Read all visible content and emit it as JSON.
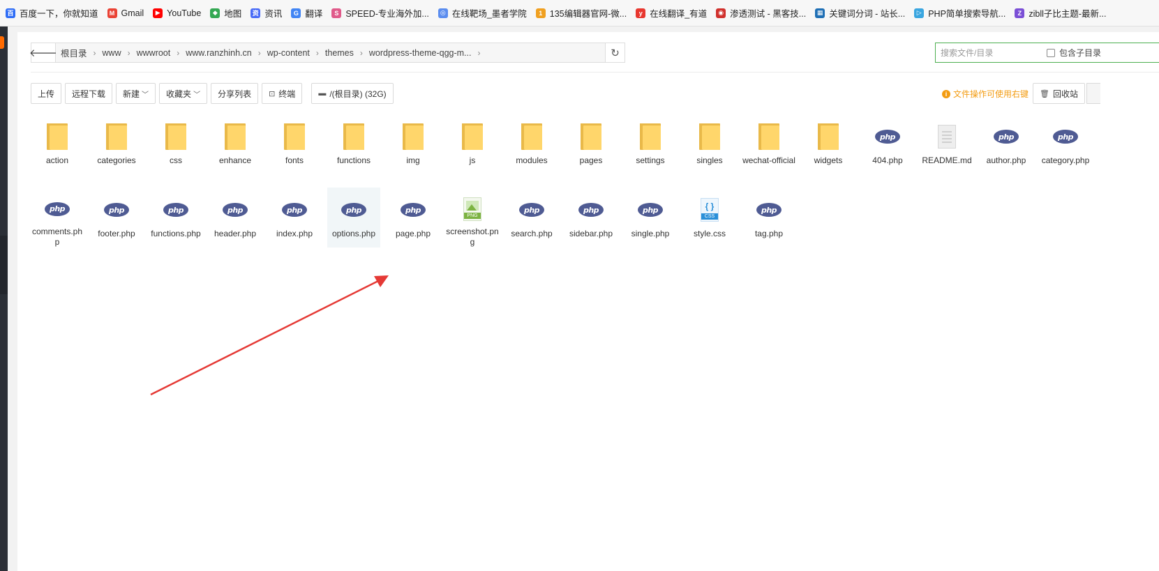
{
  "bookmarks": [
    {
      "label": "百度一下，你就知道",
      "icon": "baidu-icon",
      "color": "#2f6df6",
      "glyph": "百"
    },
    {
      "label": "Gmail",
      "icon": "gmail-icon",
      "color": "#ea4335",
      "glyph": "M"
    },
    {
      "label": "YouTube",
      "icon": "youtube-icon",
      "color": "#ff0000",
      "glyph": "▶"
    },
    {
      "label": "地图",
      "icon": "maps-icon",
      "color": "#34a853",
      "glyph": "◆"
    },
    {
      "label": "资讯",
      "icon": "news-icon",
      "color": "#4a6cf7",
      "glyph": "资"
    },
    {
      "label": "翻译",
      "icon": "translate-icon",
      "color": "#4285f4",
      "glyph": "G"
    },
    {
      "label": "SPEED-专业海外加...",
      "icon": "speed-icon",
      "color": "#e05a8a",
      "glyph": "S"
    },
    {
      "label": "在线靶场_墨者学院",
      "icon": "mozhe-icon",
      "color": "#5b8def",
      "glyph": "◎"
    },
    {
      "label": "135编辑器官网-微...",
      "icon": "editor135-icon",
      "color": "#f0a020",
      "glyph": "1"
    },
    {
      "label": "在线翻译_有道",
      "icon": "youdao-icon",
      "color": "#e8372f",
      "glyph": "y"
    },
    {
      "label": "渗透测试 - 黑客技...",
      "icon": "pentest-icon",
      "color": "#d0312d",
      "glyph": "◉"
    },
    {
      "label": "关键词分词 - 站长...",
      "icon": "keyword-icon",
      "color": "#1f6fb5",
      "glyph": "▦"
    },
    {
      "label": "PHP简单搜索导航...",
      "icon": "php-search-icon",
      "color": "#3aa6e0",
      "glyph": "▷"
    },
    {
      "label": "zibll子比主题-最新...",
      "icon": "zibll-icon",
      "color": "#7b4fd6",
      "glyph": "Z"
    }
  ],
  "address": {
    "crumbs": [
      "根目录",
      "www",
      "wwwroot",
      "www.ranzhinh.cn",
      "wp-content",
      "themes",
      "wordpress-theme-qgg-m..."
    ]
  },
  "search": {
    "placeholder": "搜索文件/目录",
    "checkbox_label": "包含子目录"
  },
  "toolbar": {
    "upload": "上传",
    "remote_download": "远程下载",
    "new": "新建",
    "favorites": "收藏夹",
    "share_list": "分享列表",
    "terminal": "终端",
    "disk": "/(根目录) (32G)"
  },
  "hint": "文件操作可使用右键",
  "recycle": "回收站",
  "files_row1": [
    {
      "name": "action",
      "type": "folder"
    },
    {
      "name": "categories",
      "type": "folder"
    },
    {
      "name": "css",
      "type": "folder"
    },
    {
      "name": "enhance",
      "type": "folder"
    },
    {
      "name": "fonts",
      "type": "folder"
    },
    {
      "name": "functions",
      "type": "folder"
    },
    {
      "name": "img",
      "type": "folder"
    },
    {
      "name": "js",
      "type": "folder"
    },
    {
      "name": "modules",
      "type": "folder"
    },
    {
      "name": "pages",
      "type": "folder"
    },
    {
      "name": "settings",
      "type": "folder"
    },
    {
      "name": "singles",
      "type": "folder"
    },
    {
      "name": "wechat-official",
      "type": "folder"
    },
    {
      "name": "widgets",
      "type": "folder"
    },
    {
      "name": "404.php",
      "type": "php"
    },
    {
      "name": "README.md",
      "type": "doc"
    },
    {
      "name": "author.php",
      "type": "php"
    },
    {
      "name": "category.php",
      "type": "php"
    }
  ],
  "files_row2": [
    {
      "name": "comments.php",
      "type": "php"
    },
    {
      "name": "footer.php",
      "type": "php"
    },
    {
      "name": "functions.php",
      "type": "php"
    },
    {
      "name": "header.php",
      "type": "php"
    },
    {
      "name": "index.php",
      "type": "php"
    },
    {
      "name": "options.php",
      "type": "php",
      "selected": true
    },
    {
      "name": "page.php",
      "type": "php"
    },
    {
      "name": "screenshot.png",
      "type": "png"
    },
    {
      "name": "search.php",
      "type": "php"
    },
    {
      "name": "sidebar.php",
      "type": "php"
    },
    {
      "name": "single.php",
      "type": "php"
    },
    {
      "name": "style.css",
      "type": "css"
    },
    {
      "name": "tag.php",
      "type": "php"
    }
  ],
  "icon_labels": {
    "php": "php",
    "png": "PNG",
    "css_tag": "CSS",
    "css_braces": "{ }"
  },
  "colors": {
    "accent_green": "#4caf50",
    "hint_orange": "#f39c12",
    "php_badge": "#4f5b93",
    "annotation_arrow": "#e53935"
  }
}
